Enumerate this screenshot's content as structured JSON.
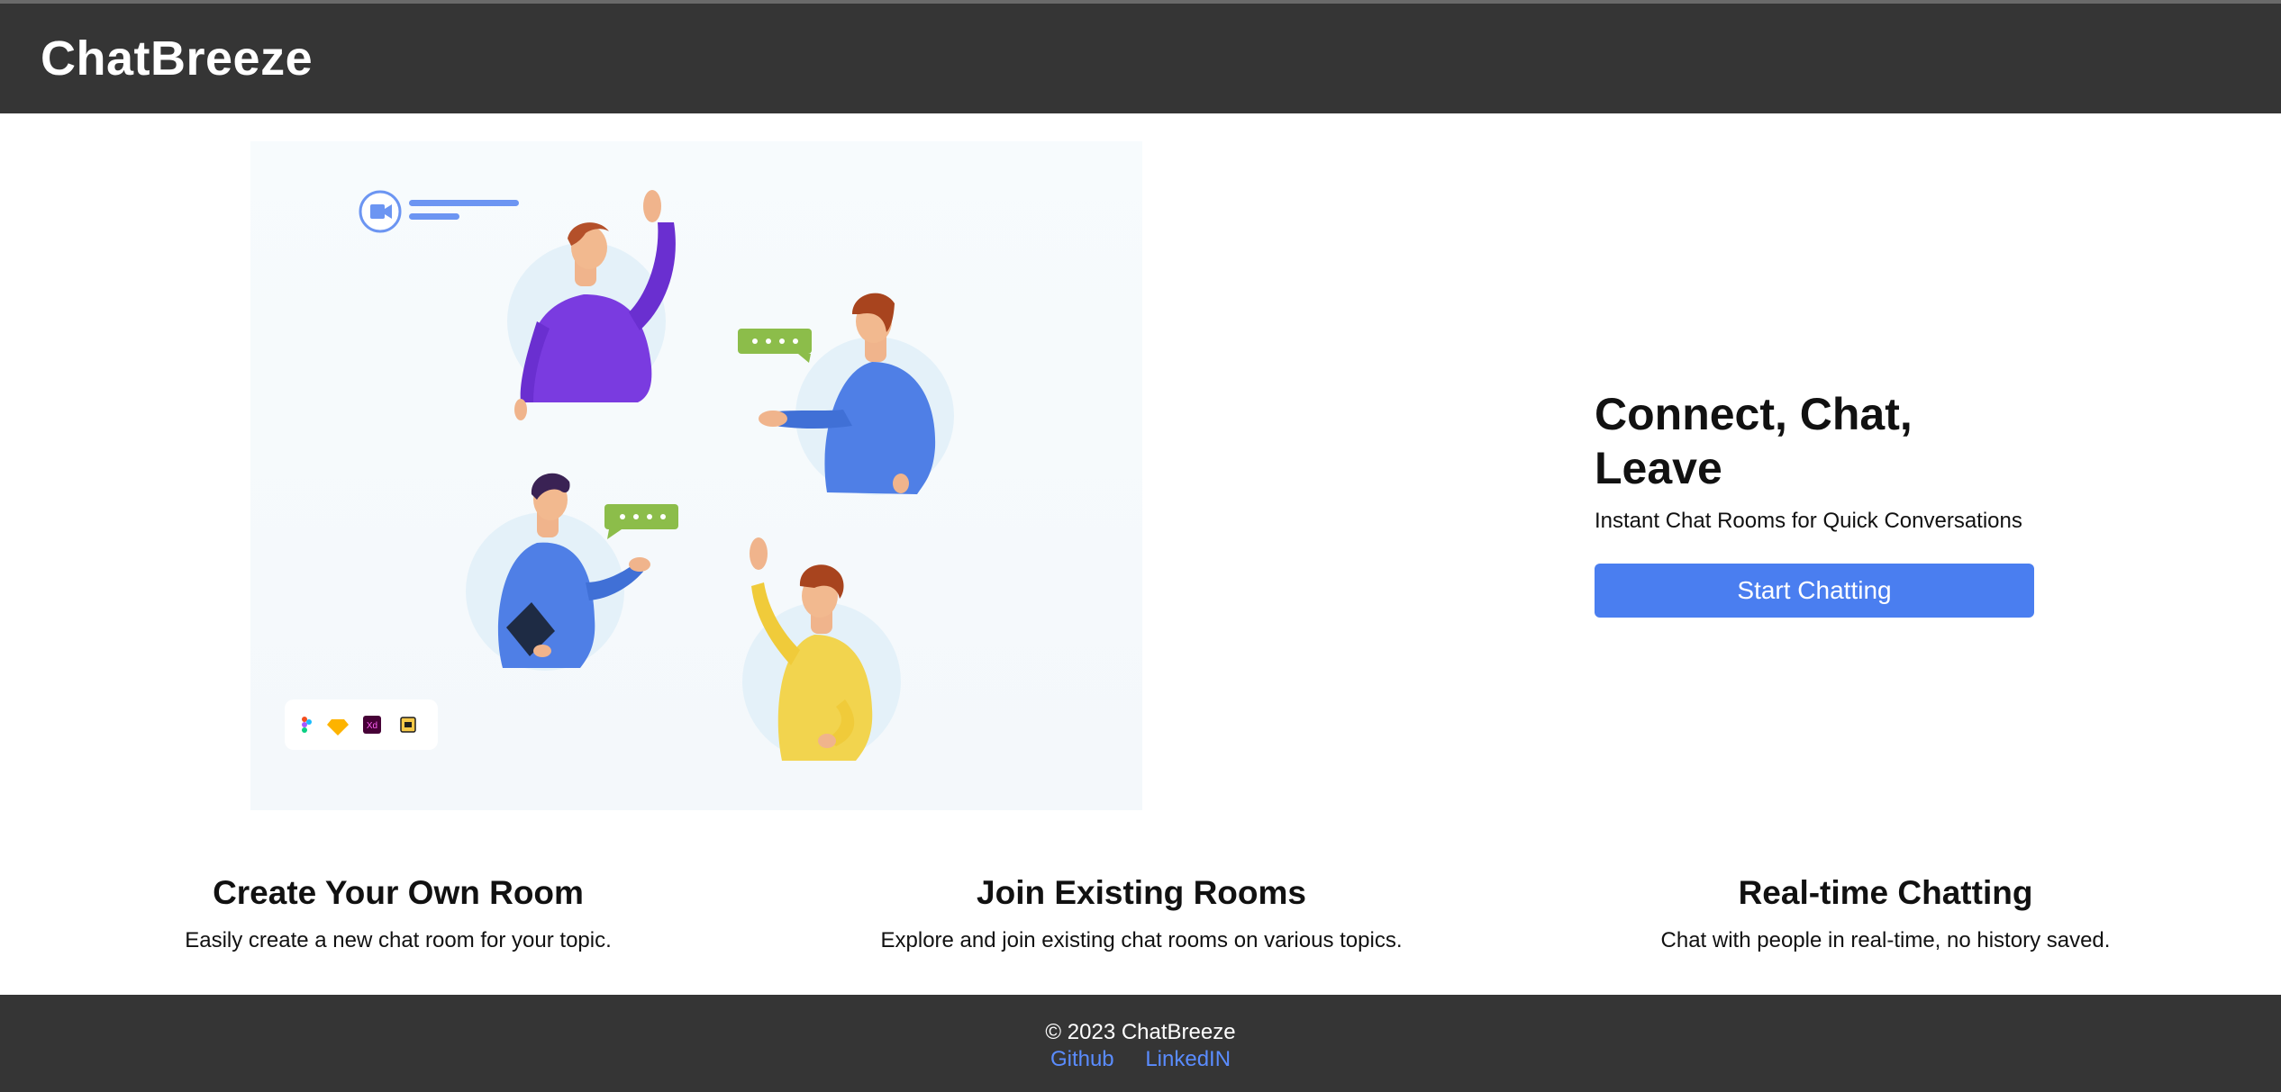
{
  "header": {
    "brand": "ChatBreeze"
  },
  "hero": {
    "title": "Connect, Chat, Leave",
    "subtitle": "Instant Chat Rooms for Quick Conversations",
    "cta_label": "Start Chatting",
    "illustration_tool_icons": [
      "figma-icon",
      "sketch-icon",
      "xd-icon",
      "layers-icon"
    ],
    "illustration_tool_labels": {
      "xd": "Xd"
    }
  },
  "features": [
    {
      "title": "Create Your Own Room",
      "description": "Easily create a new chat room for your topic."
    },
    {
      "title": "Join Existing Rooms",
      "description": "Explore and join existing chat rooms on various topics."
    },
    {
      "title": "Real-time Chatting",
      "description": "Chat with people in real-time, no history saved."
    }
  ],
  "footer": {
    "copyright": "© 2023 ChatBreeze",
    "links": [
      {
        "label": "Github"
      },
      {
        "label": "LinkedIN"
      }
    ]
  },
  "colors": {
    "header_bg": "#353535",
    "cta": "#4a7ef0",
    "link": "#5a8cff",
    "purple_shirt": "#7a3be0",
    "blue_shirt": "#4f7fe6",
    "yellow_shirt": "#f2d44e",
    "chat_bubble": "#8cbd4a"
  }
}
